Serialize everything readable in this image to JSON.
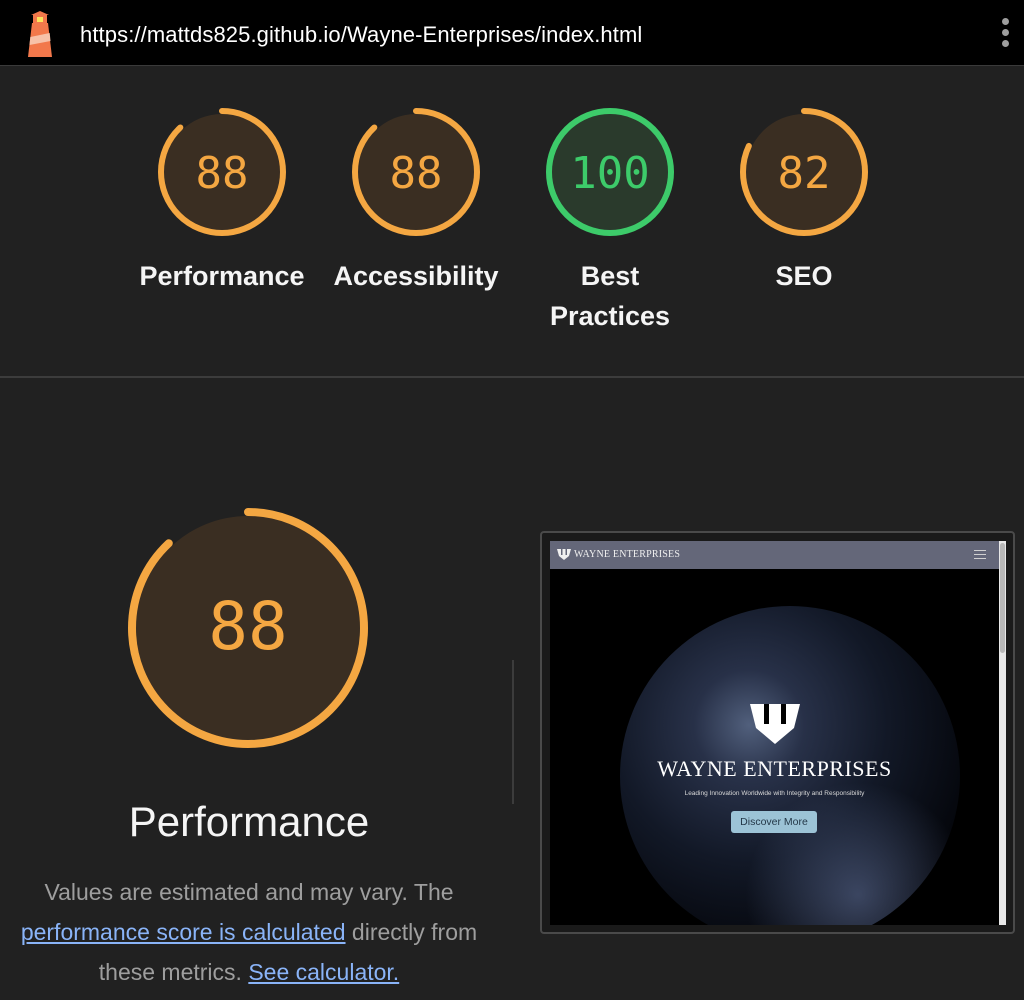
{
  "header": {
    "url": "https://mattds825.github.io/Wayne-Enterprises/index.html",
    "logo_icon": "lighthouse-icon",
    "menu_icon": "kebab-menu-icon"
  },
  "scores": [
    {
      "label": "Performance",
      "value": 88,
      "color": "#f4a742"
    },
    {
      "label": "Accessibility",
      "value": 88,
      "color": "#f4a742"
    },
    {
      "label": "Best Practices",
      "value": 100,
      "color": "#3dcb6a"
    },
    {
      "label": "SEO",
      "value": 82,
      "color": "#f4a742"
    }
  ],
  "detail": {
    "score": 88,
    "title": "Performance",
    "desc_part1": "Values are estimated and may vary. The",
    "desc_link1": "performance score is calculated",
    "desc_part2": "directly from these metrics.",
    "desc_link2": "See calculator."
  },
  "screenshot": {
    "nav_brand": "WAYNE ENTERPRISES",
    "hero_title": "WAYNE ENTERPRISES",
    "hero_subtitle": "Leading Innovation Worldwide with Integrity and Responsibility",
    "hero_button": "Discover More"
  },
  "colors": {
    "orange": "#f4a742",
    "orange_bg": "#3a2e22",
    "green": "#3dcb6a",
    "green_bg": "#2a3a2c",
    "link": "#8ab4f8"
  }
}
